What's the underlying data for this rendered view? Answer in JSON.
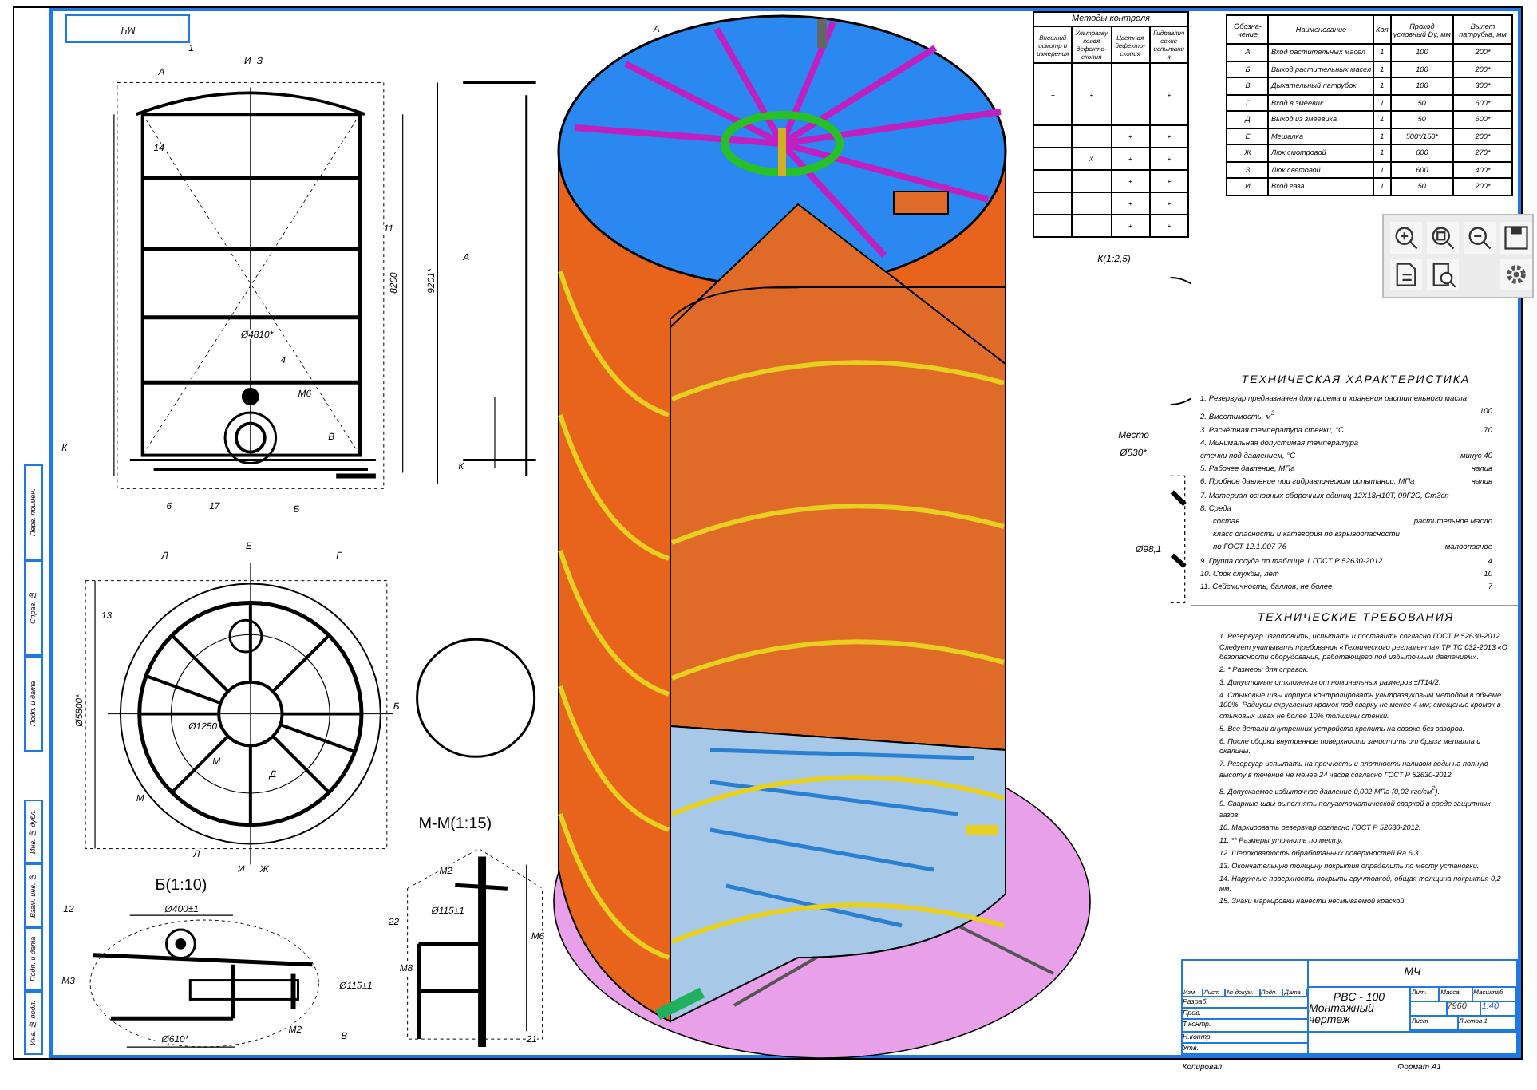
{
  "stamp": "МЧ",
  "side_strip": [
    "Перв. примен.",
    "Справ. №",
    "Подп. и дата",
    "Инв. № дубл.",
    "Взам. инв. №",
    "Подп. и дата",
    "Инв. № подл."
  ],
  "drawings": [
    {
      "kind": "elevation",
      "labels": [
        "1",
        "А",
        "И",
        "З",
        "14",
        "11",
        "4",
        "М6",
        "В",
        "К",
        "К",
        "6",
        "17",
        "Б",
        "8200",
        "9201*",
        "Ø4810*",
        "А"
      ]
    },
    {
      "kind": "plan",
      "labels": [
        "Л",
        "Е",
        "Г",
        "13",
        "Ø5800*",
        "Ø1250",
        "М",
        "Д",
        "Б",
        "М",
        "И",
        "Ж",
        "Л"
      ]
    },
    {
      "kind": "detail",
      "labels": [
        "Б(1:10)",
        "12",
        "Ø400±1",
        "М3",
        "Ø115±1",
        "В",
        "М2",
        "Ø610*"
      ]
    },
    {
      "kind": "section",
      "labels": [
        "М-М(1:15)",
        "М2",
        "Ø115±1",
        "22",
        "М8",
        "М6",
        "21"
      ]
    },
    {
      "kind": "side",
      "labels": [
        "А",
        "К(1:2,5)",
        "Место",
        "Ø530*",
        "Ø98,1"
      ]
    }
  ],
  "weld_table": {
    "title": "Методы контроля",
    "columns": [
      "Внешний осмотр и измерения",
      "Ультразвуковая дефекто-скопия",
      "Цветная дефекто-скопия",
      "Гидравлические испытания"
    ],
    "rows": [
      [
        "+",
        "+",
        "",
        "+"
      ],
      [
        "",
        "",
        "+",
        "+"
      ],
      [
        "",
        "X",
        "+",
        "+"
      ],
      [
        "",
        "",
        "+",
        "+"
      ],
      [
        "",
        "",
        "+",
        "+"
      ],
      [
        "",
        "",
        "+",
        "+"
      ]
    ]
  },
  "nozzle_table": {
    "columns": [
      "Обозна-чение",
      "Наименование",
      "Кол",
      "Проход условный Dу, мм",
      "Вылет патрубка, мм"
    ],
    "rows": [
      [
        "А",
        "Вход растительных масел",
        "1",
        "100",
        "200*"
      ],
      [
        "Б",
        "Выход растительных масел",
        "1",
        "100",
        "200*"
      ],
      [
        "В",
        "Дыхательный патрубок",
        "1",
        "100",
        "300*"
      ],
      [
        "Г",
        "Вход в змеевик",
        "1",
        "50",
        "600*"
      ],
      [
        "Д",
        "Выход из змеевика",
        "1",
        "50",
        "600*"
      ],
      [
        "Е",
        "Мешалка",
        "1",
        "500*/150*",
        "200*"
      ],
      [
        "Ж",
        "Люк смотровой",
        "1",
        "600",
        "270*"
      ],
      [
        "З",
        "Люк световой",
        "1",
        "600",
        "400*"
      ],
      [
        "И",
        "Вход газа",
        "1",
        "50",
        "200*"
      ]
    ]
  },
  "tech_characteristics": {
    "title": "ТЕХНИЧЕСКАЯ ХАРАКТЕРИСТИКА",
    "items": [
      {
        "label": "1. Резервуар предназначен для приема и хранения растительного масла",
        "value": ""
      },
      {
        "label": "2. Вместимость, м$^{3}$",
        "value": "100"
      },
      {
        "label": "3. Расчётная температура стенки, °С",
        "value": "70"
      },
      {
        "label": "4. Минимальная допустимая температура",
        "value": ""
      },
      {
        "label": "стенки под давлением, °С",
        "value": "минус 40"
      },
      {
        "label": "5. Рабочее давление, МПа",
        "value": "налив"
      },
      {
        "label": "6. Пробное давление при гидравлическом испытании, МПа",
        "value": "налив"
      },
      {
        "label": "7. Материал основных сборочных единиц 12Х18Н10Т, 09Г2С, Ст3сп",
        "value": ""
      },
      {
        "label": "8. Среда",
        "value": ""
      },
      {
        "label": "      состав",
        "value": "растительное масло"
      },
      {
        "label": "      класс опасности и категория по взрывоопасности",
        "value": ""
      },
      {
        "label": "      по ГОСТ 12.1.007-76",
        "value": "малоопасное"
      },
      {
        "label": "9. Группа сосуда по таблице 1 ГОСТ Р 52630-2012",
        "value": "4"
      },
      {
        "label": "10. Срок службы, лет",
        "value": "10"
      },
      {
        "label": "11. Сейсмичность, баллов, не более",
        "value": "7"
      }
    ]
  },
  "tech_requirements": {
    "title": "ТЕХНИЧЕСКИЕ ТРЕБОВАНИЯ",
    "items": [
      "1. Резервуар изготовить, испытать и поставить согласно ГОСТ Р 52630-2012. Следует учитывать требования «Технического регламента» ТР ТС 032-2013 «О безопасности оборудования, работающего под избыточным давлением».",
      "2. * Размеры для справок.",
      "3. Допустимые отклонения от номинальных размеров ±IT14/2.",
      "4. Стыковые швы корпуса контролировать ультразвуковым методом в объеме 100%. Радиусы скругления кромок под сварку не менее 4 мм; смещение кромок в стыковых швах не более 10% толщины стенки.",
      "5. Все детали внутренних устройств крепить на сварке без зазоров.",
      "6. После сборки внутренние поверхности зачистить от брызг металла и окалины.",
      "7. Резервуар испытать на прочность и плотность наливом воды на полную высоту в течение не менее 24 часов согласно ГОСТ Р 52630-2012.",
      "8. Допускаемое избыточное давление 0,002 МПа (0,02 кгс/см$^{2}$).",
      "9. Сварные швы выполнять полуавтоматической сваркой в среде защитных газов.",
      "10. Маркировать резервуар согласно ГОСТ Р 52630-2012.",
      "11. ** Размеры уточнить по месту.",
      "12. Шероховатость обработанных поверхностей Ra 6,3.",
      "13. Окончательную толщину покрытия определить по месту установки.",
      "14. Наружные поверхности покрыть грунтовкой, общая толщина покрытия 0,2 мм.",
      "15. Знаки маркировки нанести несмываемой краской."
    ]
  },
  "title_block": {
    "code": "МЧ",
    "name": "РВС - 100",
    "subtitle": "Монтажный чертеж",
    "headers": [
      "Лит.",
      "Масса",
      "Масштаб"
    ],
    "mass": "7960",
    "scale": "1:40",
    "sheet": "Лист",
    "sheets": "Листов 1",
    "cols": [
      "Изм.",
      "Лист",
      "№ докум.",
      "Подп.",
      "Дата"
    ],
    "roles": [
      "Разраб.",
      "Пров.",
      "Т.контр.",
      "Н.контр.",
      "Утв."
    ]
  },
  "footer": {
    "copied": "Копировал",
    "format": "Формат A1"
  }
}
